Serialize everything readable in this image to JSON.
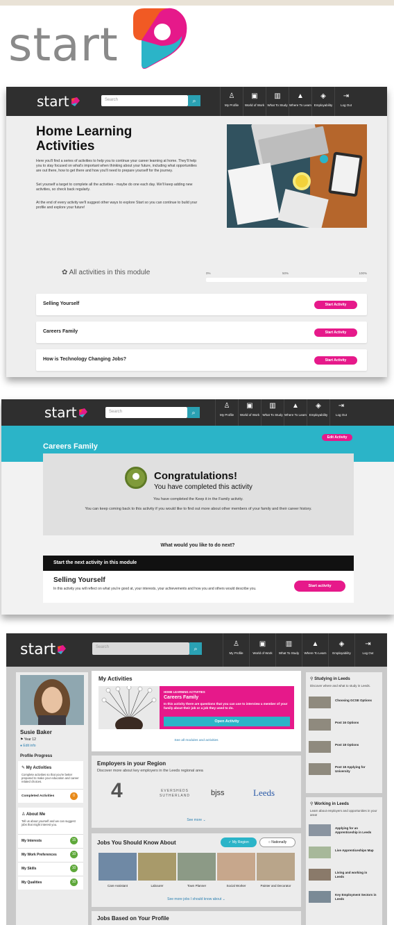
{
  "logo": {
    "word": "start"
  },
  "colors": {
    "magenta": "#e6198a",
    "teal": "#2bb4c8",
    "navbar": "#2f2f2f",
    "orange": "#f15a24"
  },
  "nav": {
    "brand": "start",
    "search_placeholder": "Search",
    "search_icon": "search-icon",
    "items": [
      {
        "label": "My Profile",
        "icon": "person-icon"
      },
      {
        "label": "World of Work",
        "icon": "briefcase-icon"
      },
      {
        "label": "What To Study",
        "icon": "book-icon"
      },
      {
        "label": "Where To Learn",
        "icon": "graduation-cap-icon"
      },
      {
        "label": "Employability",
        "icon": "box-icon"
      },
      {
        "label": "Log Out",
        "icon": "logout-icon"
      }
    ]
  },
  "home_learning": {
    "title": "Home Learning Activities",
    "paragraphs": [
      "Here you'll find a series of activities to help you to continue your career learning at home. They'll help you to stay focused on what's important when thinking about your future, including what opportunities are out there, how to get there and how you'll need to prepare yourself for the journey.",
      "Set yourself a target to complete all the activities - maybe do one each day. We'll keep adding new activities, so check back regularly.",
      "At the end of every activity we'll suggest other ways to explore Start so you can continue to build your profile and explore your future!"
    ],
    "module_heading": "All activities in this module",
    "progress_labels": [
      "0%",
      "50%",
      "100%"
    ],
    "progress_value": 0,
    "start_label": "Start Activity",
    "activities": [
      "Selling Yourself",
      "Careers Family",
      "How is Technology Changing Jobs?"
    ]
  },
  "careers_family": {
    "title": "Careers Family",
    "edit_label": "Edit Activity",
    "congrats": "Congratulations!",
    "completed": "You have completed this activity",
    "completed_detail": "You have completed the Keep it in the Family activity.",
    "keep_coming": "You can keep coming back to this activity if you would like to find out more about other members of your family and their career history.",
    "next_question": "What would you like to do next?",
    "next_bar": "Start the next activity in this module",
    "next_title": "Selling Yourself",
    "next_desc": "In this activity you will reflect on what you're good at, your interests, your achievements and how you and others would describe you.",
    "next_button": "Start activity"
  },
  "dashboard": {
    "profile": {
      "name": "Susie Baker",
      "year": "Year 12",
      "edit": "Edit info"
    },
    "progress_heading": "Profile Progress",
    "my_activities": {
      "title": "My Activities",
      "desc": "Complete activities so that you're better prepared to make your education and career related choices.",
      "completed_label": "Completed Activities",
      "completed_count": "0"
    },
    "about_me": {
      "title": "About Me",
      "desc": "Tell us about yourself and we can suggest jobs that might interest you.",
      "rows": [
        {
          "label": "My Interests",
          "count": "15"
        },
        {
          "label": "My Work Preferences",
          "count": "10"
        },
        {
          "label": "My Skills",
          "count": "10"
        },
        {
          "label": "My Qualities",
          "count": "10"
        }
      ]
    },
    "activities_panel": {
      "title": "My Activities",
      "kicker": "HOME LEARNING ACTIVITIES",
      "card_title": "Careers Family",
      "card_desc": "In this activity there are questions that you can use to interview a member of your family about their job or a job they used to do.",
      "open_label": "Open Activity",
      "see_all": "See all modules and activities"
    },
    "employers": {
      "title": "Employers in your Region",
      "subtitle": "Discover more about key employers in the Leeds regional area",
      "logos": [
        "4",
        "EVERSHEDS SUTHERLAND",
        "bjss",
        "Leeds"
      ],
      "see_more": "See more"
    },
    "jobs": {
      "title": "Jobs You Should Know About",
      "toggle": [
        "My Region",
        "Nationally"
      ],
      "items": [
        "Care Assistant",
        "Labourer",
        "Town Planner",
        "Social Worker",
        "Painter and Decorator"
      ],
      "more": "See more jobs I should know about"
    },
    "jobs_profile_title": "Jobs Based on Your Profile",
    "studying": {
      "title": "Studying in Leeds",
      "desc": "Discover where and what to study in Leeds.",
      "items": [
        "Choosing GCSE Options",
        "Post 16 Options",
        "Post 18 Options",
        "Post 18 Applying for University"
      ]
    },
    "working": {
      "title": "Working in Leeds",
      "desc": "Learn about employers and opportunities in your area!",
      "items": [
        "Applying for an Apprenticeship in Leeds",
        "Live Apprenticeships Map",
        "Living and working in Leeds",
        "Key Employment Sectors in Leeds"
      ]
    }
  }
}
